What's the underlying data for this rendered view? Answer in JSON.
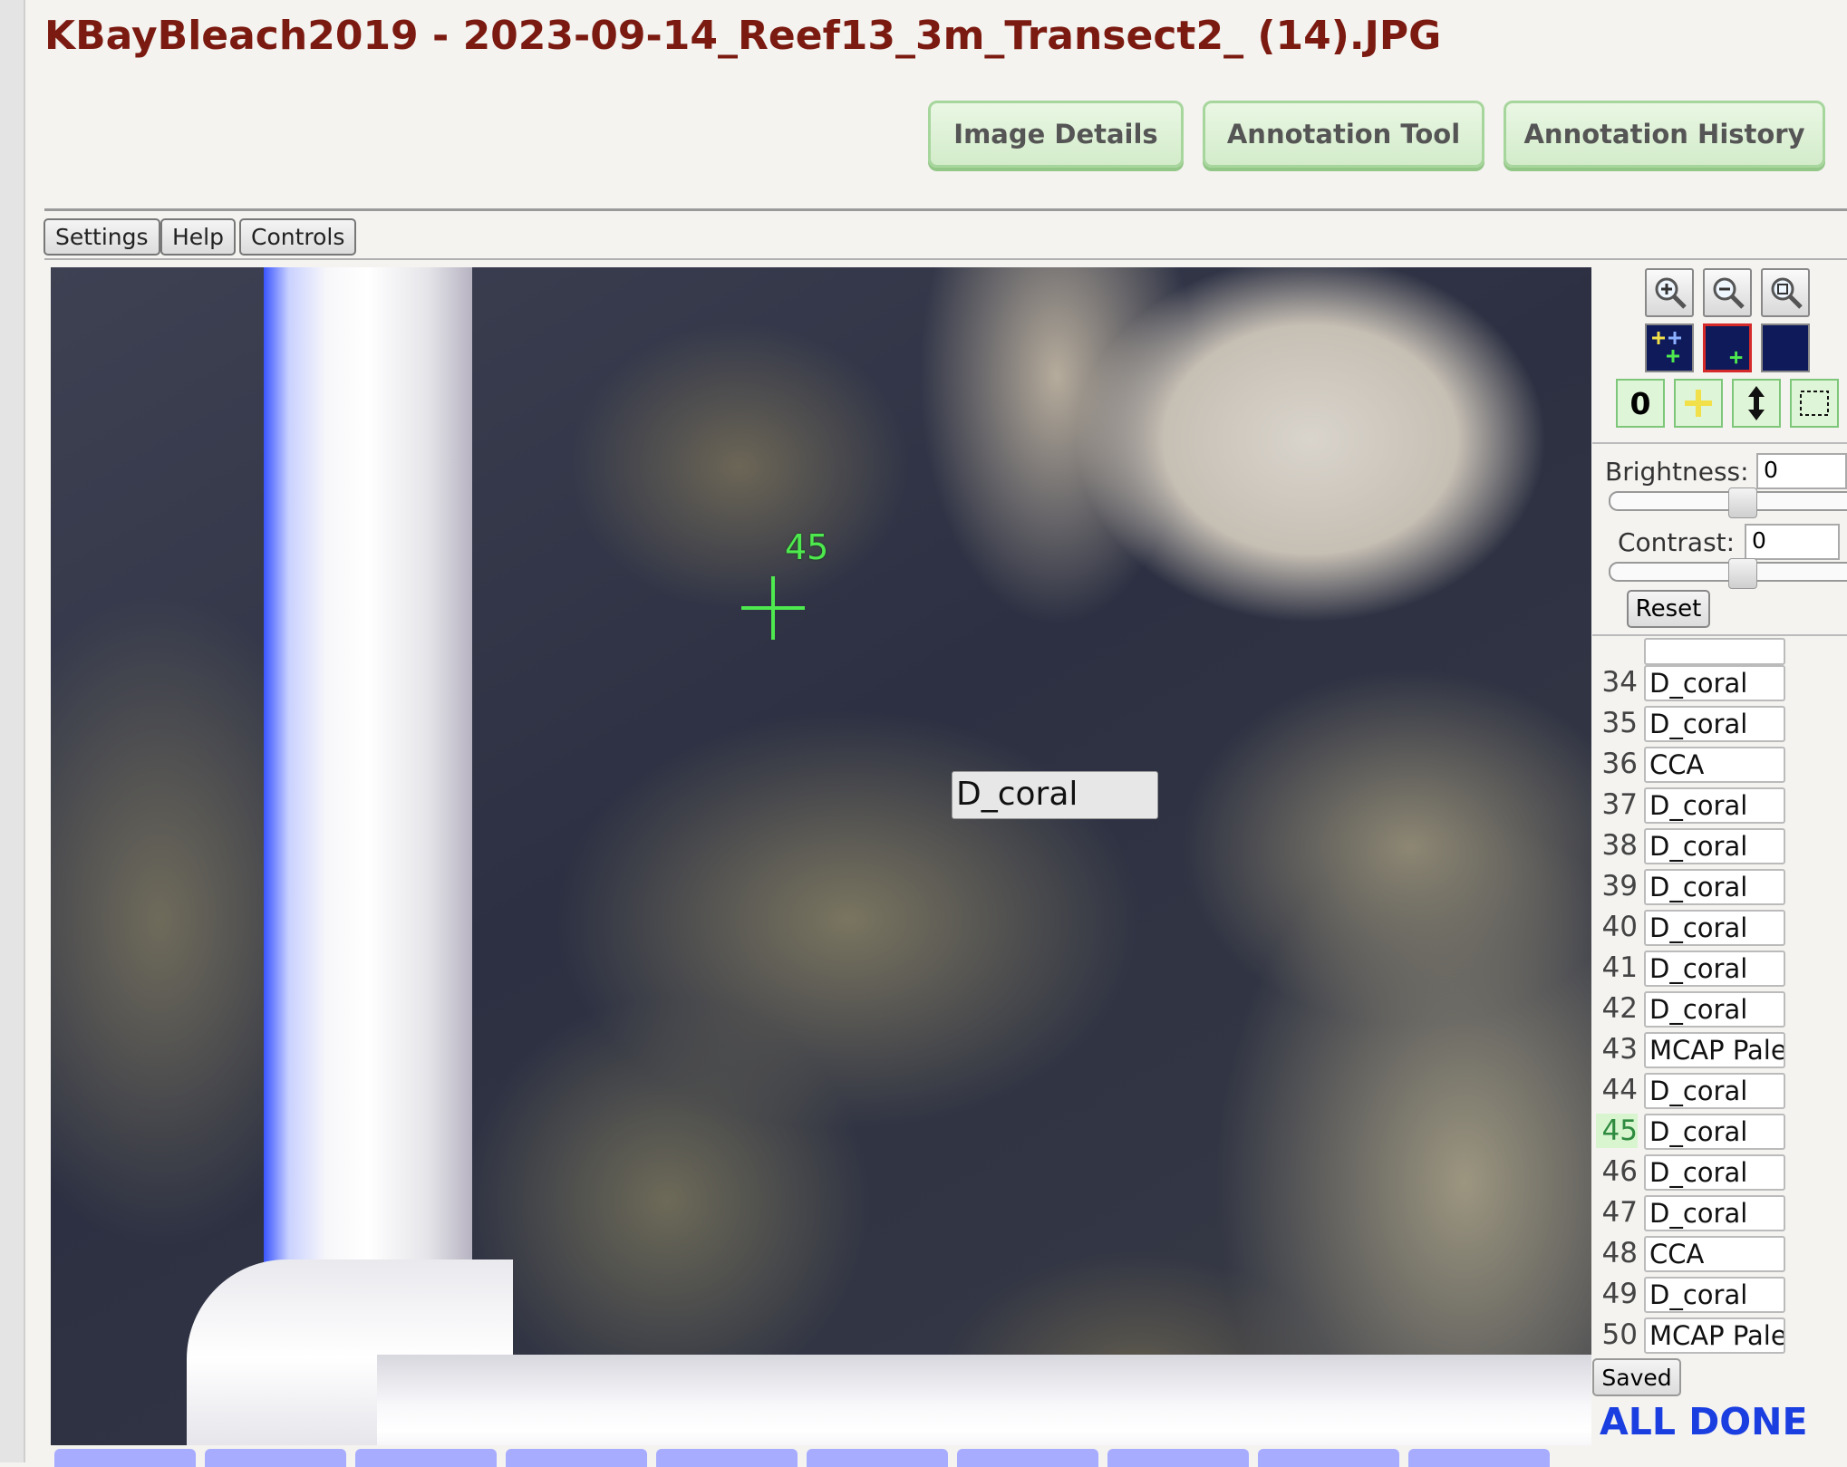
{
  "page": {
    "title": "KBayBleach2019 - 2023-09-14_Reef13_3m_Transect2_ (14).JPG"
  },
  "nav": {
    "image_details": "Image Details",
    "annotation_tool": "Annotation Tool",
    "annotation_history": "Annotation History"
  },
  "toolbar": {
    "settings": "Settings",
    "help": "Help",
    "controls": "Controls"
  },
  "image_view": {
    "current_point_number": "45",
    "hover_label": "D_coral",
    "colors": {
      "crosshair": "#4ee94e"
    }
  },
  "tools": {
    "zoom_in_icon": "zoom-in-icon",
    "zoom_out_icon": "zoom-out-icon",
    "zoom_fit_icon": "zoom-fit-icon",
    "point_count_label": "0"
  },
  "adjustments": {
    "brightness_label": "Brightness:",
    "brightness_value": "0",
    "contrast_label": "Contrast:",
    "contrast_value": "0",
    "reset_label": "Reset"
  },
  "annotations": {
    "current_point": 45,
    "rows": [
      {
        "num": "34",
        "label": "D_coral"
      },
      {
        "num": "35",
        "label": "D_coral"
      },
      {
        "num": "36",
        "label": "CCA"
      },
      {
        "num": "37",
        "label": "D_coral"
      },
      {
        "num": "38",
        "label": "D_coral"
      },
      {
        "num": "39",
        "label": "D_coral"
      },
      {
        "num": "40",
        "label": "D_coral"
      },
      {
        "num": "41",
        "label": "D_coral"
      },
      {
        "num": "42",
        "label": "D_coral"
      },
      {
        "num": "43",
        "label": "MCAP Pale"
      },
      {
        "num": "44",
        "label": "D_coral"
      },
      {
        "num": "45",
        "label": "D_coral"
      },
      {
        "num": "46",
        "label": "D_coral"
      },
      {
        "num": "47",
        "label": "D_coral"
      },
      {
        "num": "48",
        "label": "CCA"
      },
      {
        "num": "49",
        "label": "D_coral"
      },
      {
        "num": "50",
        "label": "MCAP Pale"
      }
    ]
  },
  "footer": {
    "saved_label": "Saved",
    "status": "ALL DONE"
  },
  "colors": {
    "title": "#7b1a10",
    "status": "#1a3ee0",
    "nav_button": "#d3ecca"
  }
}
